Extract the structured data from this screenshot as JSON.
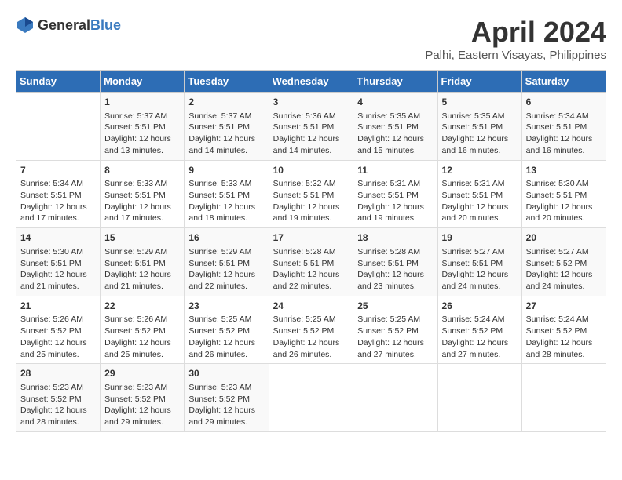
{
  "header": {
    "logo_general": "General",
    "logo_blue": "Blue",
    "month": "April 2024",
    "location": "Palhi, Eastern Visayas, Philippines"
  },
  "weekdays": [
    "Sunday",
    "Monday",
    "Tuesday",
    "Wednesday",
    "Thursday",
    "Friday",
    "Saturday"
  ],
  "weeks": [
    [
      {
        "day": "",
        "data": ""
      },
      {
        "day": "1",
        "data": "Sunrise: 5:37 AM\nSunset: 5:51 PM\nDaylight: 12 hours\nand 13 minutes."
      },
      {
        "day": "2",
        "data": "Sunrise: 5:37 AM\nSunset: 5:51 PM\nDaylight: 12 hours\nand 14 minutes."
      },
      {
        "day": "3",
        "data": "Sunrise: 5:36 AM\nSunset: 5:51 PM\nDaylight: 12 hours\nand 14 minutes."
      },
      {
        "day": "4",
        "data": "Sunrise: 5:35 AM\nSunset: 5:51 PM\nDaylight: 12 hours\nand 15 minutes."
      },
      {
        "day": "5",
        "data": "Sunrise: 5:35 AM\nSunset: 5:51 PM\nDaylight: 12 hours\nand 16 minutes."
      },
      {
        "day": "6",
        "data": "Sunrise: 5:34 AM\nSunset: 5:51 PM\nDaylight: 12 hours\nand 16 minutes."
      }
    ],
    [
      {
        "day": "7",
        "data": "Sunrise: 5:34 AM\nSunset: 5:51 PM\nDaylight: 12 hours\nand 17 minutes."
      },
      {
        "day": "8",
        "data": "Sunrise: 5:33 AM\nSunset: 5:51 PM\nDaylight: 12 hours\nand 17 minutes."
      },
      {
        "day": "9",
        "data": "Sunrise: 5:33 AM\nSunset: 5:51 PM\nDaylight: 12 hours\nand 18 minutes."
      },
      {
        "day": "10",
        "data": "Sunrise: 5:32 AM\nSunset: 5:51 PM\nDaylight: 12 hours\nand 19 minutes."
      },
      {
        "day": "11",
        "data": "Sunrise: 5:31 AM\nSunset: 5:51 PM\nDaylight: 12 hours\nand 19 minutes."
      },
      {
        "day": "12",
        "data": "Sunrise: 5:31 AM\nSunset: 5:51 PM\nDaylight: 12 hours\nand 20 minutes."
      },
      {
        "day": "13",
        "data": "Sunrise: 5:30 AM\nSunset: 5:51 PM\nDaylight: 12 hours\nand 20 minutes."
      }
    ],
    [
      {
        "day": "14",
        "data": "Sunrise: 5:30 AM\nSunset: 5:51 PM\nDaylight: 12 hours\nand 21 minutes."
      },
      {
        "day": "15",
        "data": "Sunrise: 5:29 AM\nSunset: 5:51 PM\nDaylight: 12 hours\nand 21 minutes."
      },
      {
        "day": "16",
        "data": "Sunrise: 5:29 AM\nSunset: 5:51 PM\nDaylight: 12 hours\nand 22 minutes."
      },
      {
        "day": "17",
        "data": "Sunrise: 5:28 AM\nSunset: 5:51 PM\nDaylight: 12 hours\nand 22 minutes."
      },
      {
        "day": "18",
        "data": "Sunrise: 5:28 AM\nSunset: 5:51 PM\nDaylight: 12 hours\nand 23 minutes."
      },
      {
        "day": "19",
        "data": "Sunrise: 5:27 AM\nSunset: 5:51 PM\nDaylight: 12 hours\nand 24 minutes."
      },
      {
        "day": "20",
        "data": "Sunrise: 5:27 AM\nSunset: 5:52 PM\nDaylight: 12 hours\nand 24 minutes."
      }
    ],
    [
      {
        "day": "21",
        "data": "Sunrise: 5:26 AM\nSunset: 5:52 PM\nDaylight: 12 hours\nand 25 minutes."
      },
      {
        "day": "22",
        "data": "Sunrise: 5:26 AM\nSunset: 5:52 PM\nDaylight: 12 hours\nand 25 minutes."
      },
      {
        "day": "23",
        "data": "Sunrise: 5:25 AM\nSunset: 5:52 PM\nDaylight: 12 hours\nand 26 minutes."
      },
      {
        "day": "24",
        "data": "Sunrise: 5:25 AM\nSunset: 5:52 PM\nDaylight: 12 hours\nand 26 minutes."
      },
      {
        "day": "25",
        "data": "Sunrise: 5:25 AM\nSunset: 5:52 PM\nDaylight: 12 hours\nand 27 minutes."
      },
      {
        "day": "26",
        "data": "Sunrise: 5:24 AM\nSunset: 5:52 PM\nDaylight: 12 hours\nand 27 minutes."
      },
      {
        "day": "27",
        "data": "Sunrise: 5:24 AM\nSunset: 5:52 PM\nDaylight: 12 hours\nand 28 minutes."
      }
    ],
    [
      {
        "day": "28",
        "data": "Sunrise: 5:23 AM\nSunset: 5:52 PM\nDaylight: 12 hours\nand 28 minutes."
      },
      {
        "day": "29",
        "data": "Sunrise: 5:23 AM\nSunset: 5:52 PM\nDaylight: 12 hours\nand 29 minutes."
      },
      {
        "day": "30",
        "data": "Sunrise: 5:23 AM\nSunset: 5:52 PM\nDaylight: 12 hours\nand 29 minutes."
      },
      {
        "day": "",
        "data": ""
      },
      {
        "day": "",
        "data": ""
      },
      {
        "day": "",
        "data": ""
      },
      {
        "day": "",
        "data": ""
      }
    ]
  ]
}
